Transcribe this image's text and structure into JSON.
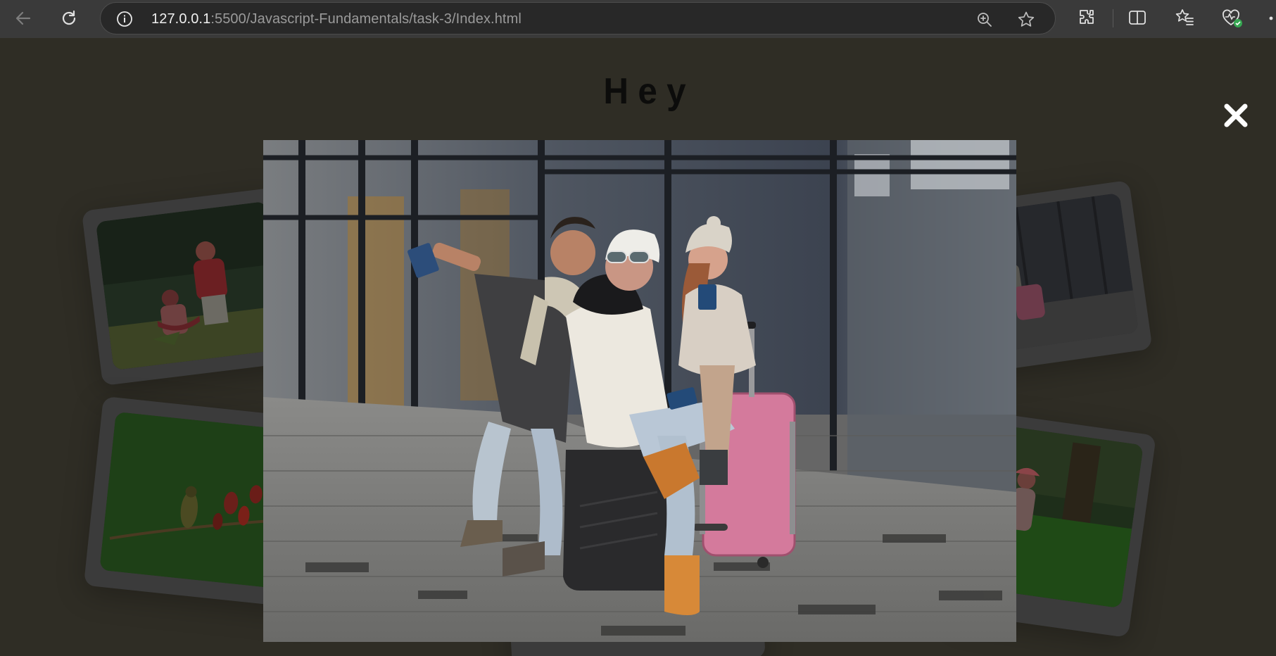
{
  "browser": {
    "url_host": "127.0.0.1",
    "url_rest": ":5500/Javascript-Fundamentals/task-3/Index.html",
    "icons": [
      "back-icon",
      "refresh-icon",
      "site-info-icon",
      "zoom-icon",
      "favorite-star-icon",
      "extensions-icon",
      "split-screen-icon",
      "favorites-icon",
      "browser-essentials-icon"
    ]
  },
  "page": {
    "heading": "Hey",
    "close_symbol": "✖",
    "colors": {
      "background": "#2f2d25",
      "chrome": "#3a3a3a",
      "card": "#3b3b3b",
      "heading": "#0c0c0b"
    }
  }
}
